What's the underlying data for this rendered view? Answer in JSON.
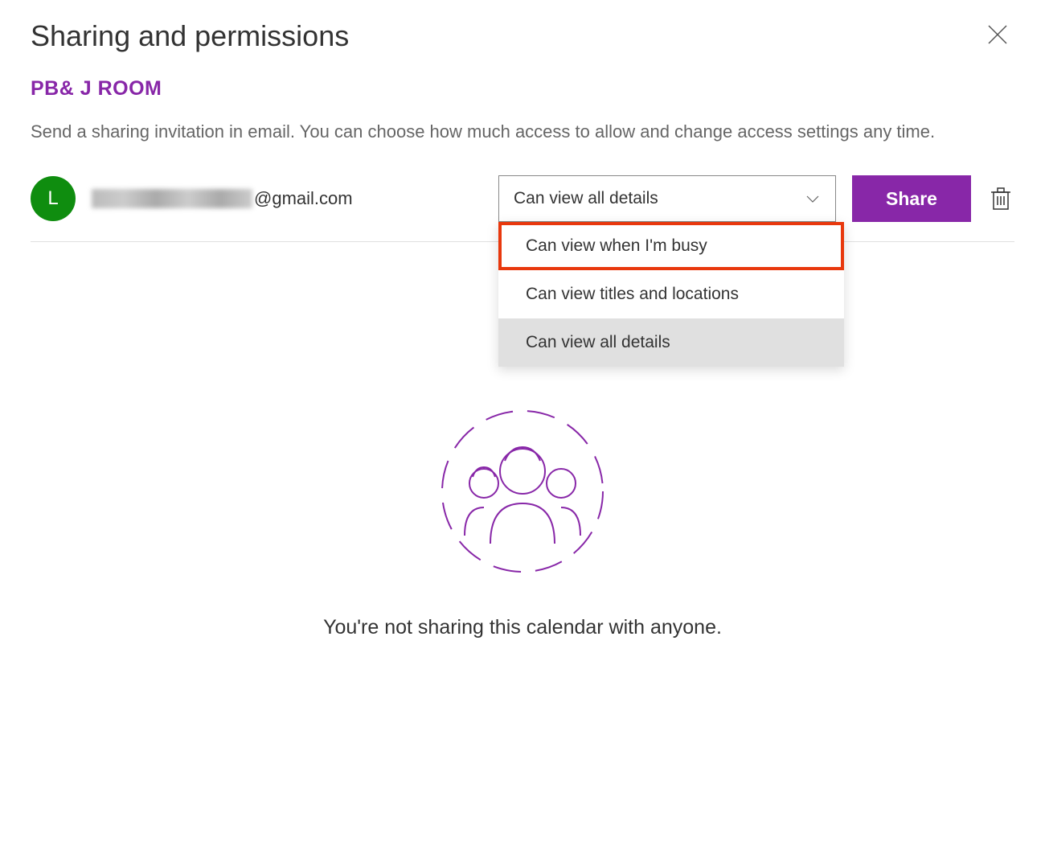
{
  "page_title": "Sharing and permissions",
  "room_name": "PB& J ROOM",
  "description": "Send a sharing invitation in email. You can choose how much access to allow and change access settings any time.",
  "sharing_entry": {
    "avatar_initial": "L",
    "avatar_color": "#0f8d0f",
    "email_suffix": "@gmail.com",
    "selected_permission": "Can view all details",
    "permission_options": [
      "Can view when I'm busy",
      "Can view titles and locations",
      "Can view all details"
    ],
    "share_button": "Share"
  },
  "empty_state_text": "You're not sharing this calendar with anyone.",
  "colors": {
    "accent": "#8827a8",
    "highlight": "#e8380d"
  }
}
